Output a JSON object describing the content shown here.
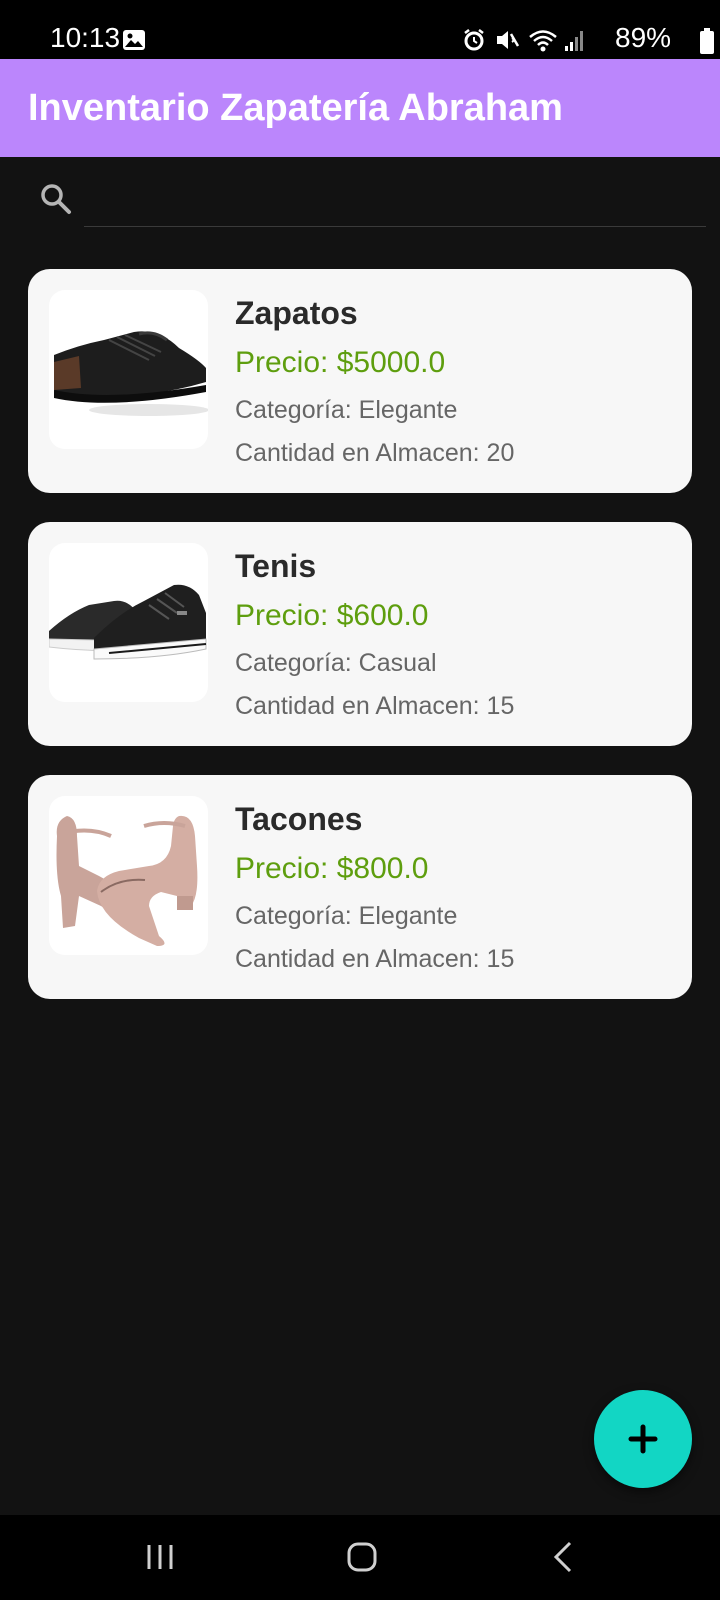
{
  "status_bar": {
    "time": "10:13",
    "battery": "89%",
    "icons": [
      "gallery-icon",
      "alarm-icon",
      "mute-icon",
      "wifi-icon",
      "signal-icon",
      "battery-icon"
    ]
  },
  "app_bar": {
    "title": "Inventario Zapatería Abraham",
    "color": "#bb86fc"
  },
  "search": {
    "placeholder": "",
    "value": ""
  },
  "products": [
    {
      "name": "Zapatos",
      "price": "Precio: $5000.0",
      "category": "Categoría: Elegante",
      "quantity": "Cantidad en Almacen: 20",
      "image": "black-casual-shoe"
    },
    {
      "name": "Tenis",
      "price": "Precio: $600.0",
      "category": "Categoría: Casual",
      "quantity": "Cantidad en Almacen: 15",
      "image": "black-sneakers"
    },
    {
      "name": "Tacones",
      "price": "Precio: $800.0",
      "category": "Categoría: Elegante",
      "quantity": "Cantidad en Almacen: 15",
      "image": "nude-block-heels"
    }
  ],
  "fab": {
    "icon": "plus-icon",
    "color": "#12d6c4"
  },
  "nav_bar": {
    "buttons": [
      "recent-apps-icon",
      "home-icon",
      "back-icon"
    ]
  },
  "colors": {
    "price": "#5e9e0e",
    "background": "#121212",
    "card": "#f7f7f7"
  }
}
